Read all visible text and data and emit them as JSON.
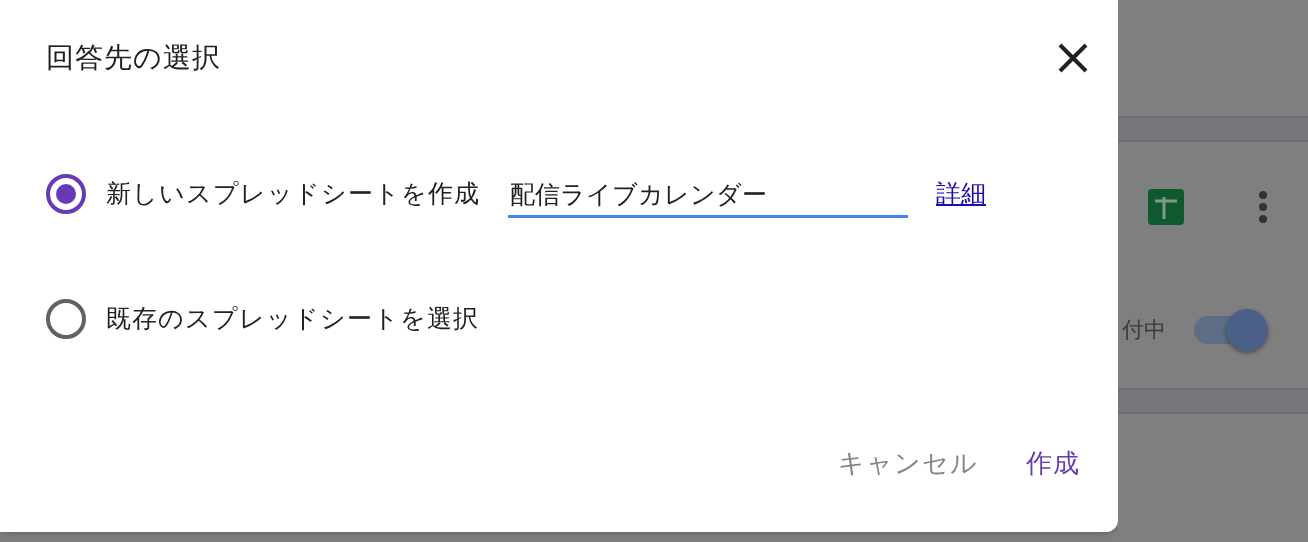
{
  "dialog": {
    "title": "回答先の選択",
    "options": [
      {
        "label": "新しいスプレッドシートを作成",
        "selected": true,
        "field": {
          "value": "配信ライブカレンダー"
        },
        "link": "詳細"
      },
      {
        "label": "既存のスプレッドシートを選択",
        "selected": false
      }
    ],
    "buttons": [
      {
        "label": "キャンセル",
        "kind": "text"
      },
      {
        "label": "作成",
        "kind": "primary"
      }
    ]
  },
  "background_card": {
    "status": "付中",
    "toggle": {
      "on": true
    }
  }
}
